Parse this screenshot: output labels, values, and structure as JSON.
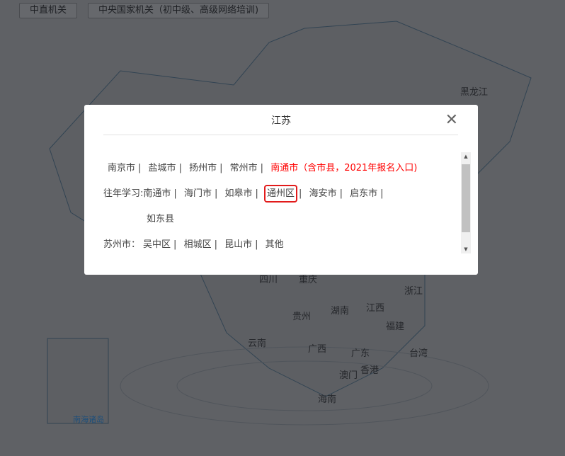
{
  "top_buttons": [
    "中直机关",
    "中央国家机关（初中级、高级网络培训)"
  ],
  "map_labels": {
    "heilongjiang": "黑龙江",
    "sichuan": "四川",
    "chongqing": "重庆",
    "zhejiang": "浙江",
    "guizhou": "贵州",
    "hunan": "湖南",
    "jiangxi": "江西",
    "fujian": "福建",
    "yunnan": "云南",
    "guangxi": "广西",
    "guangdong": "广东",
    "taiwan": "台湾",
    "hongkong": "香港",
    "macau": "澳门",
    "hainan": "海南",
    "south_sea": "南海诸岛"
  },
  "modal": {
    "title": "江苏",
    "close_icon": "close-icon",
    "row1": [
      "南京市",
      "盐城市",
      "扬州市",
      "常州市"
    ],
    "row1_highlight": "南通市（含市县，2021年报名入口)",
    "row2_label": "往年学习:",
    "row2": [
      "南通市",
      "海门市",
      "如皋市",
      "通州区",
      "海安市",
      "启东市"
    ],
    "row2_cont": "如东县",
    "row3_label": "苏州市：",
    "row3": [
      "吴中区",
      "相城区",
      "昆山市",
      "其他"
    ],
    "separator": "|"
  }
}
